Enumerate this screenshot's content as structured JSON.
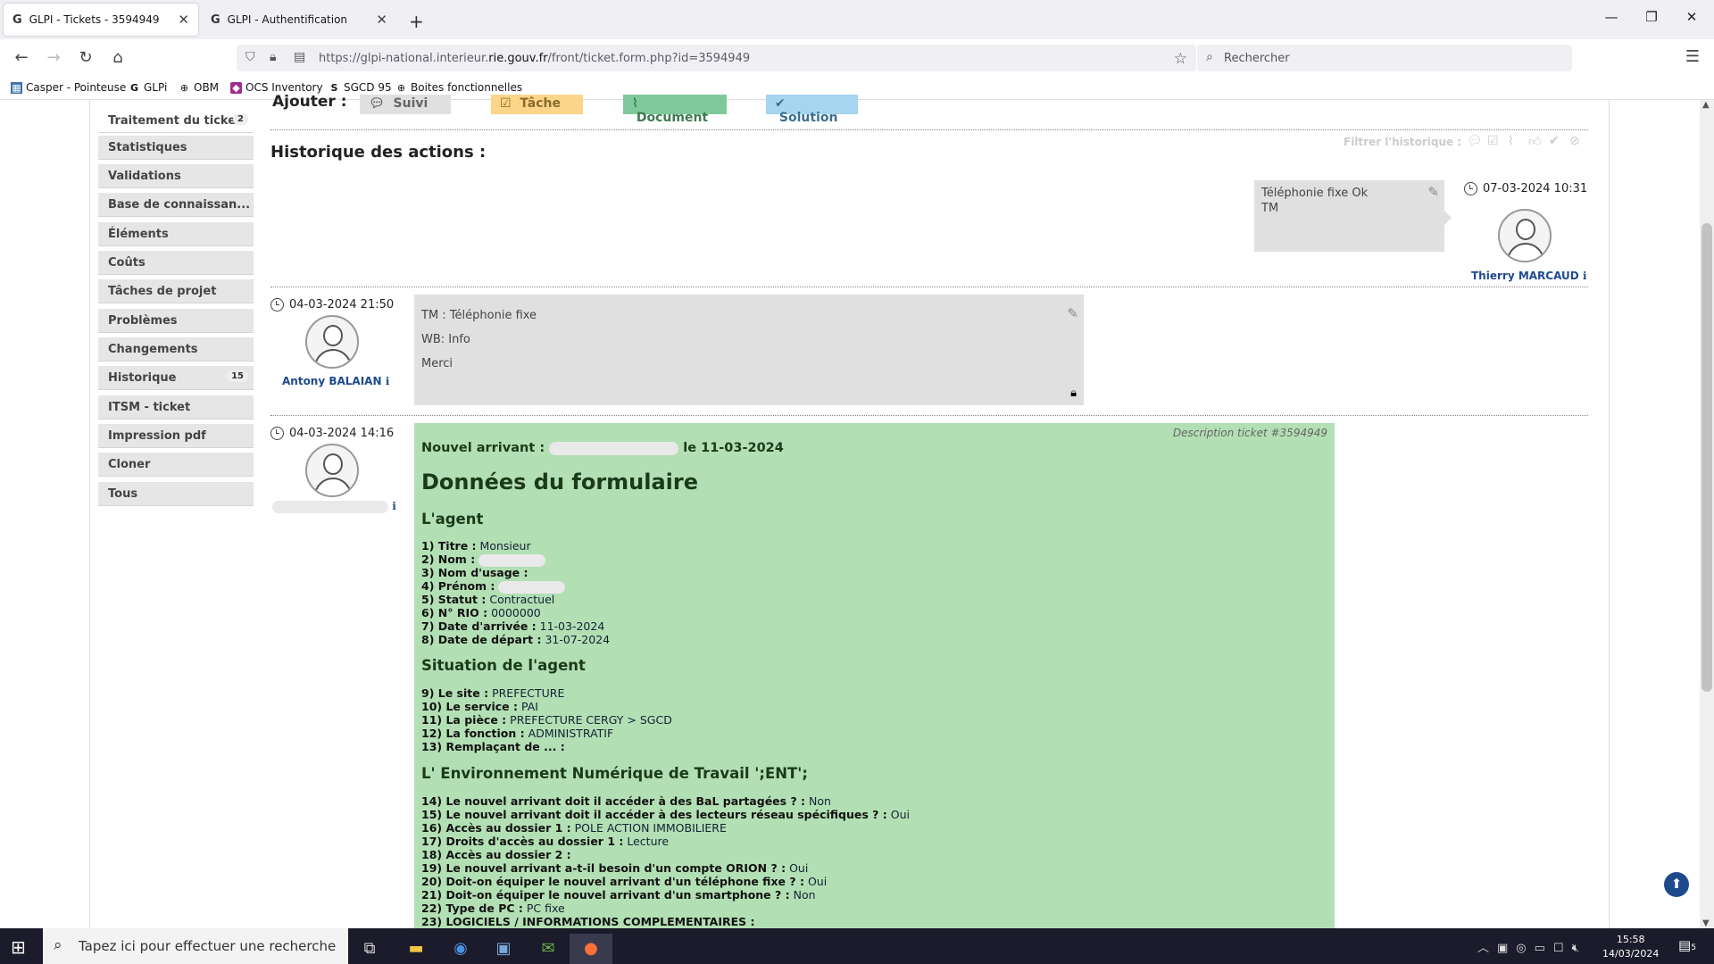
{
  "browser": {
    "tabs": [
      {
        "title": "GLPI - Tickets - 3594949",
        "active": true
      },
      {
        "title": "GLPI - Authentification",
        "active": false
      }
    ],
    "url_prefix": "https://glpi-national.interieur.",
    "url_domain": "rie.gouv.fr",
    "url_path": "/front/ticket.form.php?id=3594949",
    "search_placeholder": "Rechercher",
    "bookmarks": [
      {
        "label": "Casper - Pointeuse",
        "icon": "calendar-icon"
      },
      {
        "label": "GLPi",
        "icon": "glpi-icon"
      },
      {
        "label": "OBM",
        "icon": "globe-icon"
      },
      {
        "label": "OCS Inventory",
        "icon": "ocs-icon"
      },
      {
        "label": "SGCD 95",
        "icon": "s-icon"
      },
      {
        "label": "Boites fonctionnelles",
        "icon": "globe-icon"
      }
    ]
  },
  "sidebar": {
    "items": [
      {
        "label": "Traitement du ticket",
        "count": "2",
        "active": true
      },
      {
        "label": "Statistiques"
      },
      {
        "label": "Validations"
      },
      {
        "label": "Base de connaissan..."
      },
      {
        "label": "Éléments"
      },
      {
        "label": "Coûts"
      },
      {
        "label": "Tâches de projet"
      },
      {
        "label": "Problèmes"
      },
      {
        "label": "Changements"
      },
      {
        "label": "Historique",
        "count": "15"
      },
      {
        "label": "ITSM - ticket"
      },
      {
        "label": "Impression pdf"
      },
      {
        "label": "Cloner"
      },
      {
        "label": "Tous"
      }
    ]
  },
  "actions": {
    "label": "Ajouter :",
    "buttons": [
      {
        "label": "Suivi",
        "color": "#e0e0e0",
        "icon": "speech-bubble-icon"
      },
      {
        "label": "Tâche",
        "color": "#fbd68a",
        "icon": "checkbox-icon"
      },
      {
        "label": "Document",
        "color": "#7dc99a",
        "icon": "paperclip-icon"
      },
      {
        "label": "Solution",
        "color": "#a6d5ef",
        "icon": "check-icon"
      }
    ]
  },
  "history": {
    "title": "Historique des actions :",
    "filter_label": "Filtrer l'historique :",
    "entries": [
      {
        "time": "07-03-2024 10:31",
        "user": "Thierry MARCAUD",
        "lines": [
          "Téléphonie fixe Ok",
          "TM"
        ]
      },
      {
        "time": "04-03-2024 21:50",
        "user": "Antony BALAIAN",
        "lines": [
          "TM : Téléphonie fixe",
          "WB: Info",
          "Merci"
        ]
      },
      {
        "time": "04-03-2024 14:16",
        "user": ""
      }
    ]
  },
  "description": {
    "tag": "Description ticket #3594949",
    "arrival_prefix": "Nouvel arrivant :",
    "arrival_suffix": "le 11-03-2024",
    "title": "Données du formulaire",
    "section1": "L'agent",
    "agent_fields": [
      {
        "label": "1) Titre :",
        "value": "Monsieur"
      },
      {
        "label": "2) Nom :",
        "value": ""
      },
      {
        "label": "3) Nom d'usage :",
        "value": ""
      },
      {
        "label": "4) Prénom :",
        "value": ""
      },
      {
        "label": "5) Statut :",
        "value": "Contractuel"
      },
      {
        "label": "6) N° RIO :",
        "value": "0000000"
      },
      {
        "label": "7) Date d'arrivée :",
        "value": "11-03-2024"
      },
      {
        "label": "8) Date de départ :",
        "value": "31-07-2024"
      }
    ],
    "section2": "Situation de l'agent",
    "situation_fields": [
      {
        "label": "9) Le site :",
        "value": "PREFECTURE"
      },
      {
        "label": "10) Le service :",
        "value": "PAI"
      },
      {
        "label": "11) La pièce :",
        "value": "PREFECTURE CERGY > SGCD"
      },
      {
        "label": "12) La fonction :",
        "value": "ADMINISTRATIF"
      },
      {
        "label": "13) Remplaçant de ... :",
        "value": ""
      }
    ],
    "section3": "L' Environnement Numérique de Travail ';ENT';",
    "ent_fields": [
      {
        "label": "14) Le nouvel arrivant doit il accéder à des BaL partagées ? :",
        "value": "Non"
      },
      {
        "label": "15) Le nouvel arrivant doit il accéder à des lecteurs réseau spécifiques ? :",
        "value": "Oui"
      },
      {
        "label": "16) Accès au dossier 1 :",
        "value": "POLE ACTION IMMOBILIERE"
      },
      {
        "label": "17) Droits d'accès au dossier 1 :",
        "value": "Lecture"
      },
      {
        "label": "18) Accès au dossier 2 :",
        "value": ""
      },
      {
        "label": "19) Le nouvel arrivant a-t-il besoin d'un compte ORION ? :",
        "value": "Oui"
      },
      {
        "label": "20) Doit-on équiper le nouvel arrivant d'un téléphone fixe ? :",
        "value": "Oui"
      },
      {
        "label": "21) Doit-on équiper le nouvel arrivant d'un smartphone ? :",
        "value": "Non"
      },
      {
        "label": "22) Type de PC :",
        "value": "PC fixe"
      },
      {
        "label": "23) LOGICIELS / INFORMATIONS COMPLEMENTAIRES :",
        "value": ""
      }
    ]
  },
  "taskbar": {
    "search_placeholder": "Tapez ici pour effectuer une recherche",
    "time": "15:58",
    "date": "14/03/2024",
    "notifications": "5"
  }
}
